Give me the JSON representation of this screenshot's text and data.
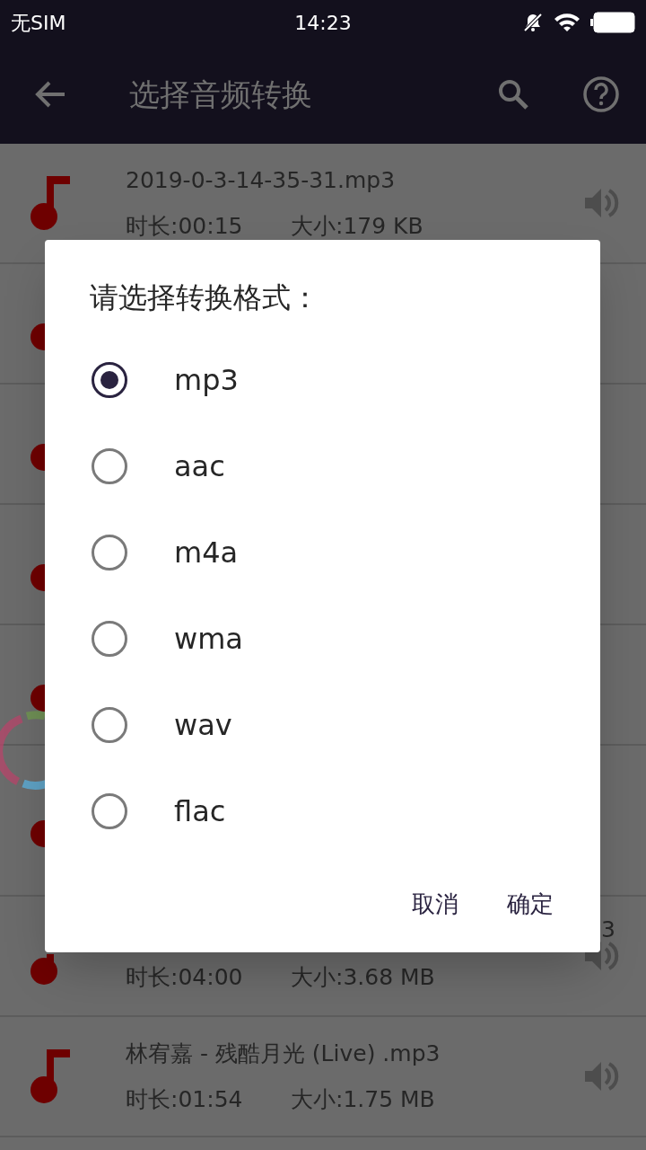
{
  "status_bar": {
    "carrier": "无SIM",
    "time": "14:23"
  },
  "app_bar": {
    "title": "选择音频转换"
  },
  "files": [
    {
      "kind": "full",
      "name": "2019-0-3-14-35-31.mp3",
      "duration": "时长:00:15",
      "size": "大小:179 KB"
    },
    {
      "kind": "covered"
    },
    {
      "kind": "covered"
    },
    {
      "kind": "covered"
    },
    {
      "kind": "covered"
    },
    {
      "kind": "covered"
    },
    {
      "kind": "partial",
      "name": "3",
      "duration": "时长:04:00",
      "size": "大小:3.68 MB"
    },
    {
      "kind": "full",
      "name": "林宥嘉 - 残酷月光 (Live) .mp3",
      "duration": "时长:01:54",
      "size": "大小:1.75 MB"
    }
  ],
  "dialog": {
    "title": "请选择转换格式：",
    "options": [
      {
        "label": "mp3",
        "selected": true
      },
      {
        "label": "aac",
        "selected": false
      },
      {
        "label": "m4a",
        "selected": false
      },
      {
        "label": "wma",
        "selected": false
      },
      {
        "label": "wav",
        "selected": false
      },
      {
        "label": "flac",
        "selected": false
      }
    ],
    "buttons": [
      "取消",
      "确定"
    ]
  }
}
